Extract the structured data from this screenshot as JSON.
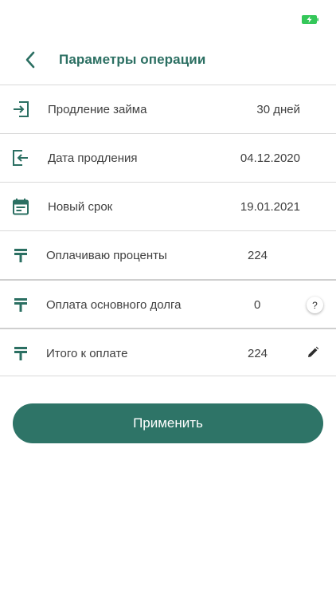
{
  "header": {
    "title": "Параметры операции"
  },
  "rows": [
    {
      "label": "Продление займа",
      "value": "30 дней",
      "icon": "login-arrow-icon"
    },
    {
      "label": "Дата продления",
      "value": "04.12.2020",
      "icon": "logout-arrow-icon"
    },
    {
      "label": "Новый срок",
      "value": "19.01.2021",
      "icon": "calendar-icon"
    },
    {
      "label": "Оплачиваю проценты",
      "value": "224",
      "icon": "tenge-icon"
    },
    {
      "label": "Оплата основного долга",
      "value": "0",
      "icon": "tenge-icon",
      "help_label": "?"
    },
    {
      "label": "Итого к оплате",
      "value": "224",
      "icon": "tenge-icon"
    }
  ],
  "apply_button": {
    "label": "Применить"
  },
  "colors": {
    "accent": "#2b6f62",
    "button": "#2e7467",
    "battery": "#34c759"
  }
}
